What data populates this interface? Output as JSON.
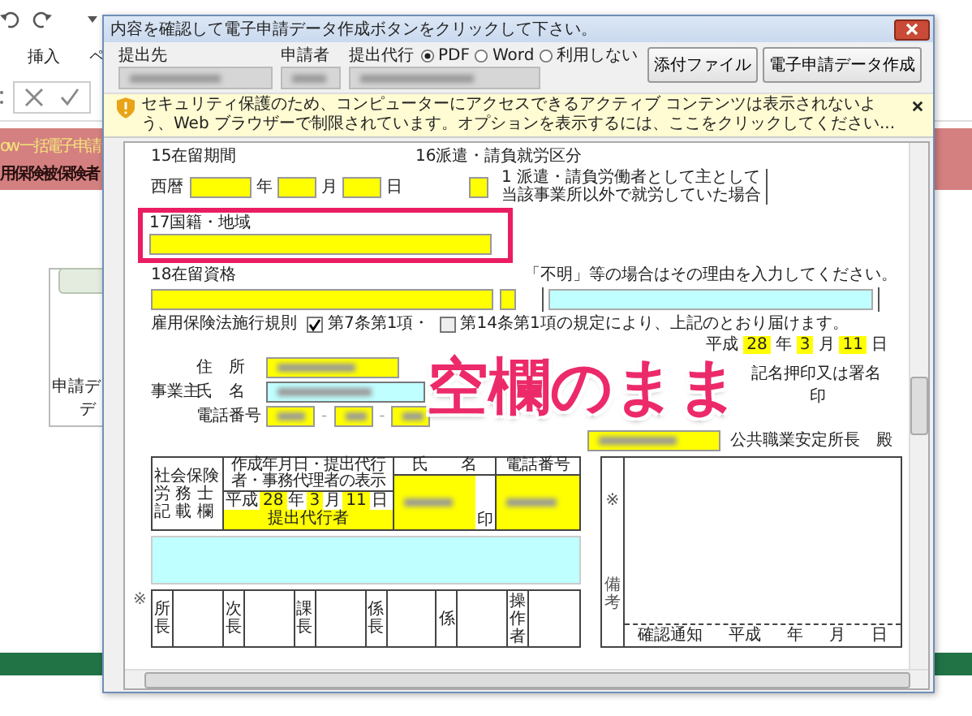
{
  "app": {
    "ribbon_tabs": [
      "挿入",
      "ペ"
    ],
    "banner_lines": [
      "ow 一括電子申請",
      "用保険被保険者"
    ],
    "card_lines": [
      "申請デ",
      "デ"
    ]
  },
  "dialog": {
    "title": "内容を確認して電子申請データ作成ボタンをクリックして下さい。",
    "labels": [
      "提出先",
      "申請者",
      "提出代行"
    ],
    "formats": [
      {
        "label": "PDF",
        "selected": true
      },
      {
        "label": "Word",
        "selected": false
      },
      {
        "label": "利用しない",
        "selected": false
      }
    ],
    "buttons": [
      "添付ファイル",
      "電子申請データ作成"
    ]
  },
  "infobar": {
    "text": "セキュリティ保護のため、コンピューターにアクセスできるアクティブ コンテンツは表示されないよう、Web ブラウザーで制限されています。オプションを表示するには、ここをクリックしてください..."
  },
  "form": {
    "period_label": "15在留期間",
    "era": "西暦",
    "ymd": [
      "年",
      "月",
      "日"
    ],
    "dispatch_label": "16派遣・請負就労区分",
    "dispatch_note": [
      "1 派遣・請負労働者として主として",
      "当該事業所以外で就労していた場合"
    ],
    "nationality_label": "17国籍・地域",
    "status_label": "18在留資格",
    "unknown_note": "「不明」等の場合はその理由を入力してください。",
    "rule_label": "雇用保険法施行規則",
    "rule_checks": [
      {
        "label": "第7条第1項・",
        "checked": true
      },
      {
        "label": "第14条第1項の規定により、上記のとおり届けます。",
        "checked": false
      }
    ],
    "date": [
      "平成",
      "28",
      "年",
      "3",
      "月",
      "11",
      "日"
    ],
    "address_label": "住　所",
    "employer_label": "事業主",
    "name_label": "氏　名",
    "phone_label": "電話番号",
    "phone_separators": [
      "-",
      "-"
    ],
    "seal_lines": [
      "記名押印又は署名",
      "印"
    ],
    "office_suffix": "公共職業安定所長　殿",
    "agent_table": {
      "side_lines": [
        "社会保険",
        "労 務 士",
        "記 載 欄"
      ],
      "headers": [
        "作成年月日・提出代行者・事務代理者の表示",
        "氏　　名",
        "電話番号"
      ],
      "date": [
        "平成",
        "28",
        "年",
        "3",
        "月",
        "11",
        "日"
      ],
      "role": "提出代行者",
      "seal": "印"
    },
    "remarks": {
      "mark": "※",
      "label": "備考",
      "confirm": [
        "確認通知",
        "平成",
        "年",
        "月",
        "日"
      ]
    },
    "approvals": {
      "mark": "※",
      "cells": [
        "所長",
        "次長",
        "課長",
        "係長",
        "係",
        "操作者"
      ]
    }
  },
  "annotation": {
    "text": "空欄のまま"
  }
}
